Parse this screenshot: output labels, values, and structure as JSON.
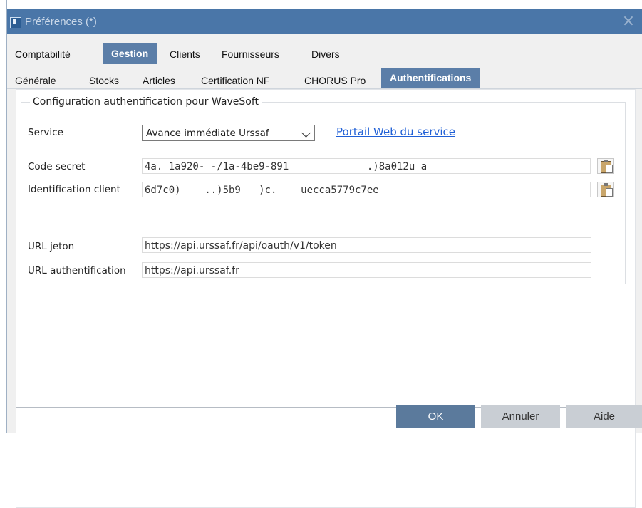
{
  "window": {
    "title": "Préférences (*)",
    "close_label": "×"
  },
  "tabs_main": [
    {
      "label": "Comptabilité"
    },
    {
      "label": "Gestion"
    },
    {
      "label": "Clients"
    },
    {
      "label": "Fournisseurs"
    },
    {
      "label": "Divers"
    }
  ],
  "tabs_sub": [
    {
      "label": "Générale"
    },
    {
      "label": "Stocks"
    },
    {
      "label": "Articles"
    },
    {
      "label": "Certification NF"
    },
    {
      "label": "CHORUS Pro"
    },
    {
      "label": "Authentifications"
    }
  ],
  "group": {
    "title": "Configuration authentification pour WaveSoft",
    "service_label": "Service",
    "service_value": "Avance immédiate Urssaf",
    "portal_link": "Portail Web du service",
    "secret_label": "Code secret",
    "secret_value": "4a. 1a920- -/1a-4be9-891             .)8a012u a",
    "client_label": "Identification client",
    "client_value": "6d7c0)    ..)5b9   )c.    uecca5779c7ee",
    "token_label": "URL jeton",
    "token_value": "https://api.urssaf.fr/api/oauth/v1/token",
    "auth_label": "URL authentification",
    "auth_value": "https://api.urssaf.fr"
  },
  "buttons": {
    "ok": "OK",
    "cancel": "Annuler",
    "help": "Aide"
  },
  "colors": {
    "titlebar": "#4a76a8",
    "active_tab": "#5b7ea8",
    "ok_button": "#5b7a9c",
    "link": "#1f5fd6"
  }
}
